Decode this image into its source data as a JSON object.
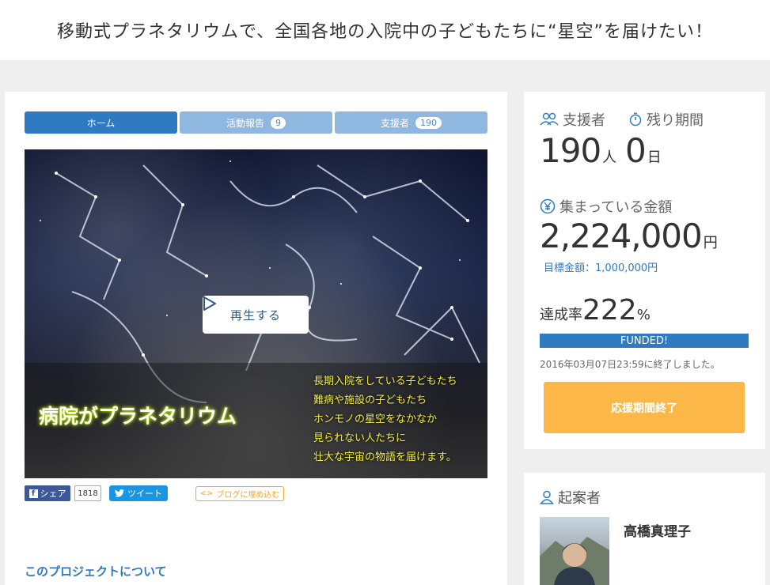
{
  "page": {
    "title": "移動式プラネタリウムで、全国各地の入院中の子どもたちに“星空”を届けたい！"
  },
  "tabs": [
    {
      "label": "ホーム",
      "count": ""
    },
    {
      "label": "活動報告",
      "count": "9"
    },
    {
      "label": "支援者",
      "count": "190"
    }
  ],
  "video": {
    "play_label": "再生する",
    "title": "病院がプラネタリウム",
    "lines": [
      "長期入院をしている子どもたち",
      "難病や施設の子どもたち",
      "ホンモノの星空をなかなか",
      "見られない人たちに",
      "壮大な宇宙の物語を届けます。"
    ]
  },
  "share": {
    "fb_label": "シェア",
    "fb_count": "1818",
    "tw_label": "ツイート",
    "embed_label": "ブログに埋め込む"
  },
  "about_link": "このプロジェクトについて",
  "stats": {
    "supporters_label": "支援者",
    "supporters_value": "190",
    "supporters_unit": "人",
    "remaining_label": "残り期間",
    "remaining_value": "0",
    "remaining_unit": "日",
    "amount_label": "集まっている金額",
    "amount_value": "2,224,000",
    "amount_unit": "円",
    "goal_text": "目標金額：1,000,000円",
    "rate_label": "達成率",
    "rate_value": "222",
    "rate_unit": "%",
    "funded_label": "FUNDED!",
    "end_text": "2016年03月07日23:59に終了しました。",
    "end_button": "応援期間終了"
  },
  "owner": {
    "label": "起案者",
    "name": "高橋真理子"
  },
  "colors": {
    "accent": "#2f7ac0",
    "tab_inactive": "#8fb7df",
    "end_button": "#fbb848",
    "facebook": "#3b5998",
    "twitter": "#1b95e0"
  }
}
